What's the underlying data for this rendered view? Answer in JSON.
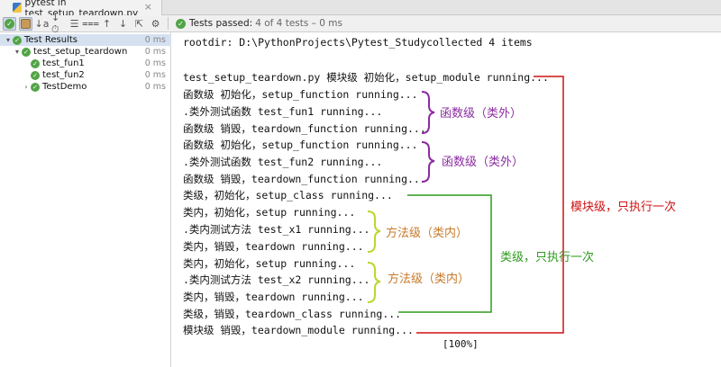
{
  "tab": {
    "title": "pytest in test_setup_teardown.py",
    "close": "×"
  },
  "toolbar": {
    "icons": [
      "show-passed-icon",
      "show-ignored-icon",
      "sort-alpha-icon",
      "sort-duration-icon",
      "expand-all-icon",
      "collapse-all-icon",
      "previous-icon",
      "next-icon",
      "export-icon",
      "settings-icon"
    ],
    "status_passed": "Tests passed:",
    "status_rest": "4 of 4 tests – 0 ms"
  },
  "tree": [
    {
      "label": "Test Results",
      "time": "0 ms",
      "arrow": "▾",
      "depth": 0
    },
    {
      "label": "test_setup_teardown",
      "time": "0 ms",
      "arrow": "▾",
      "depth": 1
    },
    {
      "label": "test_fun1",
      "time": "0 ms",
      "arrow": "",
      "depth": 2
    },
    {
      "label": "test_fun2",
      "time": "0 ms",
      "arrow": "",
      "depth": 2
    },
    {
      "label": "TestDemo",
      "time": "0 ms",
      "arrow": "›",
      "depth": 2
    }
  ],
  "console": {
    "lines": [
      "rootdir: D:\\PythonProjects\\Pytest_Studycollected 4 items",
      "",
      "test_setup_teardown.py 模块级 初始化，setup_module running...",
      "函数级 初始化，setup_function running...",
      ".类外测试函数 test_fun1 running...",
      "函数级 销毁，teardown_function running...",
      "函数级 初始化，setup_function running...",
      ".类外测试函数 test_fun2 running...",
      "函数级 销毁，teardown_function running...",
      "类级，初始化，setup_class running...",
      "类内，初始化，setup running...",
      ".类内测试方法 test_x1 running...",
      "类内，销毁，teardown running...",
      "类内，初始化，setup running...",
      ".类内测试方法 test_x2 running...",
      "类内，销毁，teardown running...",
      "类级，销毁，teardown_class running...",
      "模块级 销毁，teardown_module running..."
    ],
    "progress": "[100%]"
  },
  "annotations": {
    "func_outside_1": "函数级（类外）",
    "func_outside_2": "函数级（类外）",
    "method_inside_1": "方法级（类内）",
    "method_inside_2": "方法级（类内）",
    "class_once": "类级，只执行一次",
    "module_once": "模块级，只执行一次"
  },
  "colors": {
    "purple": "#8b2ca0",
    "yellow_green": "#b8d830",
    "orange": "#c87a2a",
    "green": "#2e9a1e",
    "red": "#d01010",
    "pass": "#52a447"
  }
}
